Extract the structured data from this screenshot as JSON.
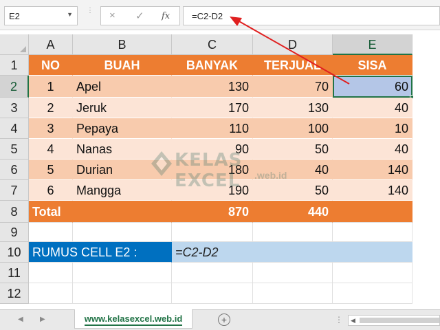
{
  "formula_bar": {
    "name_box": "E2",
    "formula": "=C2-D2",
    "cancel_icon": "×",
    "enter_icon": "✓",
    "fx_label": "fx"
  },
  "columns": [
    "A",
    "B",
    "C",
    "D",
    "E"
  ],
  "rows": [
    "1",
    "2",
    "3",
    "4",
    "5",
    "6",
    "7",
    "8",
    "9",
    "10",
    "11",
    "12"
  ],
  "table": {
    "headers": [
      "NO",
      "BUAH",
      "BANYAK",
      "TERJUAL",
      "SISA"
    ],
    "data": [
      [
        "1",
        "Apel",
        "130",
        "70",
        "60"
      ],
      [
        "2",
        "Jeruk",
        "170",
        "130",
        "40"
      ],
      [
        "3",
        "Pepaya",
        "110",
        "100",
        "10"
      ],
      [
        "4",
        "Nanas",
        "90",
        "50",
        "40"
      ],
      [
        "5",
        "Durian",
        "180",
        "40",
        "140"
      ],
      [
        "6",
        "Mangga",
        "190",
        "50",
        "140"
      ]
    ],
    "total_label": "Total",
    "total_banyak": "870",
    "total_terjual": "440"
  },
  "formula_note": {
    "label": "RUMUS CELL E2 :",
    "value": "=C2-D2"
  },
  "watermark": {
    "text": "KELAS EXCEL",
    "sub": ".web.id"
  },
  "sheet_tab": "www.kelasexcel.web.id",
  "add_sheet_icon": "+",
  "colors": {
    "header_orange": "#ed7d31",
    "row_dark": "#f8cbad",
    "row_light": "#fce4d6",
    "label_blue": "#0070c0",
    "value_blue": "#bdd7ee",
    "selection_green": "#217346",
    "arrow_red": "#e02020"
  }
}
